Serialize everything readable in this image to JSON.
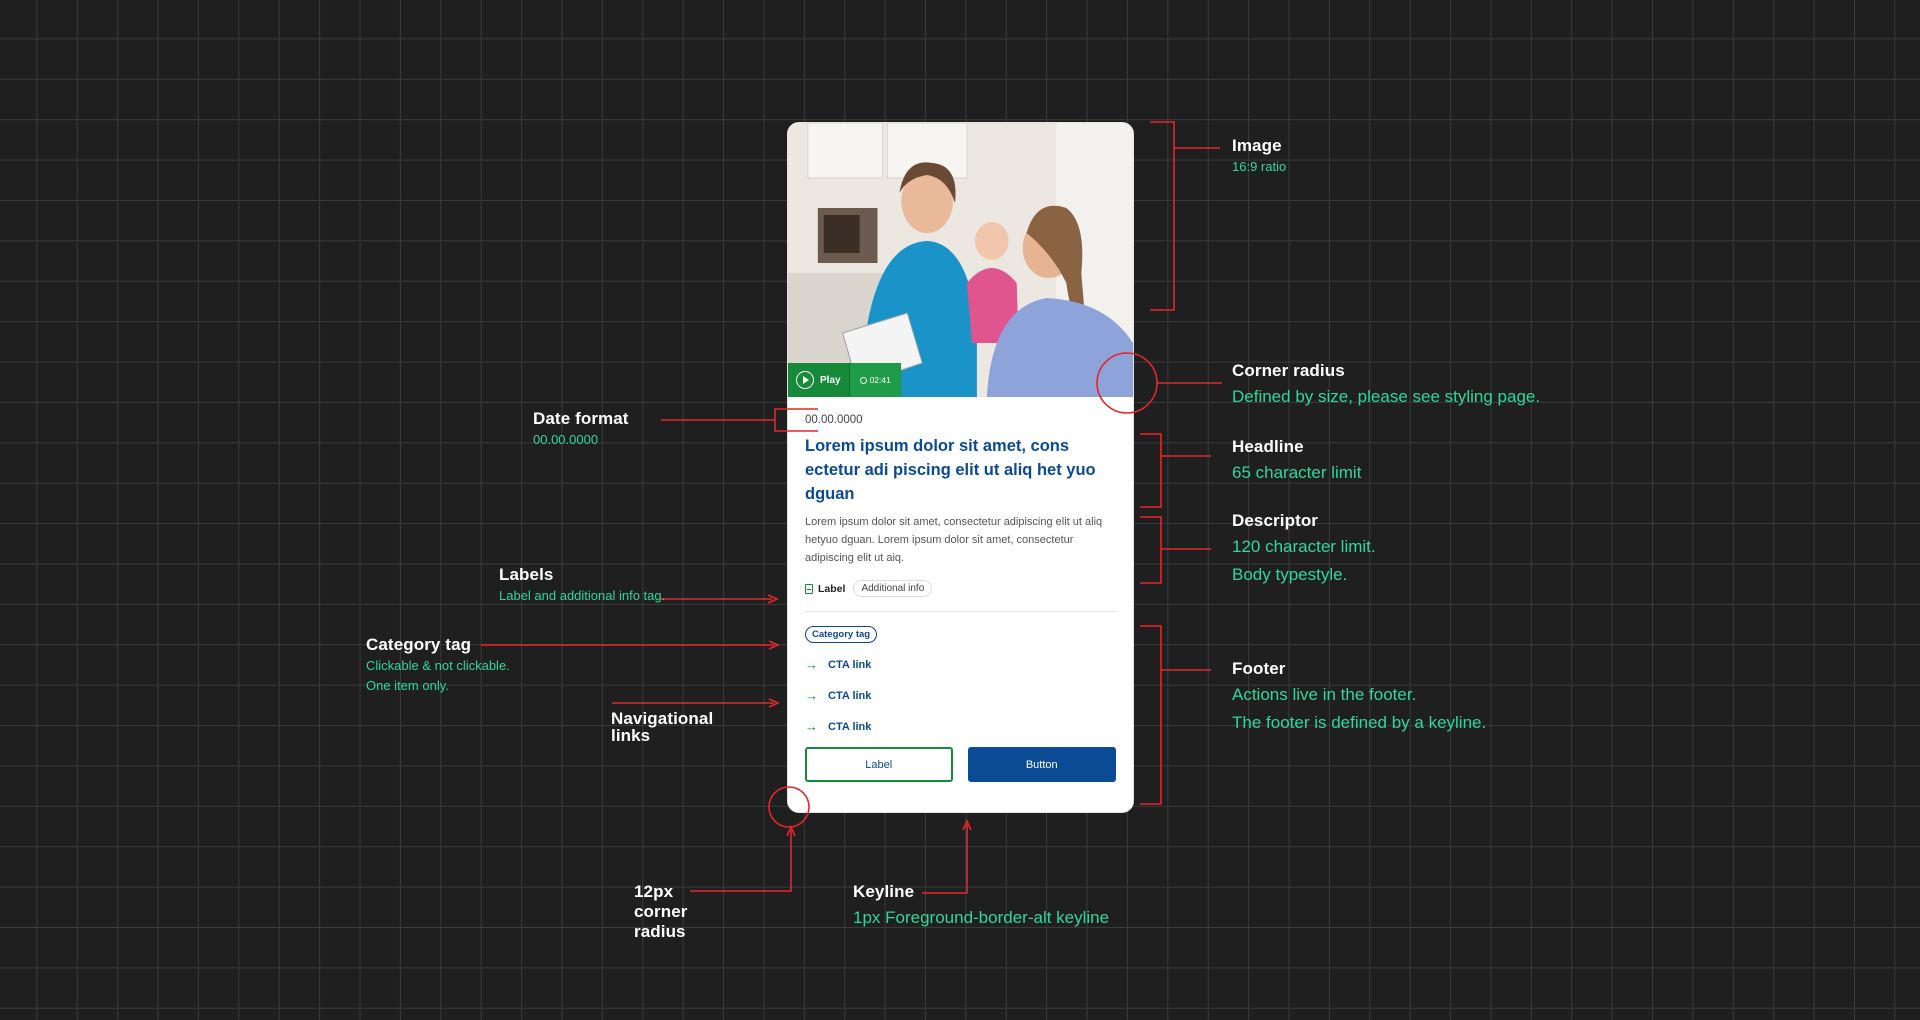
{
  "card": {
    "play_label": "Play",
    "duration": "02:41",
    "date": "00.00.0000",
    "headline": "Lorem ipsum dolor sit amet, cons ectetur adi piscing elit ut aliq het yuo dguan",
    "descriptor": "Lorem ipsum dolor sit amet, consectetur adipiscing elit ut aliq hetyuo dguan. Lorem ipsum dolor sit amet, consectetur adipiscing elit ut aiq.",
    "label": "Label",
    "additional_info": "Additional info",
    "category_tag": "Category tag",
    "cta_links": [
      "CTA link",
      "CTA link",
      "CTA link"
    ],
    "secondary_button": "Label",
    "primary_button": "Button"
  },
  "annotations": {
    "image": {
      "title": "Image",
      "note": "16:9 ratio"
    },
    "corner_radius": {
      "title": "Corner radius",
      "note": "Defined by size, please see styling page."
    },
    "headline": {
      "title": "Headline",
      "note": "65 character limit"
    },
    "descriptor": {
      "title": "Descriptor",
      "note1": "120 character limit.",
      "note2": "Body typestyle."
    },
    "footer": {
      "title": "Footer",
      "note1": "Actions live in the footer.",
      "note2": "The footer is defined by a keyline."
    },
    "date_format": {
      "title": "Date format",
      "note": "00.00.0000"
    },
    "labels": {
      "title": "Labels",
      "note": "Label and additional info tag."
    },
    "category_tag": {
      "title": "Category tag",
      "note1": "Clickable & not clickable.",
      "note2": "One item only."
    },
    "nav_links": {
      "title1": "Navigational",
      "title2": "links"
    },
    "corner_12px": {
      "title1": "12px",
      "title2": "corner",
      "title3": "radius"
    },
    "keyline": {
      "title": "Keyline",
      "note": "1px Foreground-border-alt keyline"
    }
  },
  "colors": {
    "background": "#1f1f1f",
    "annotation_line": "#e3262b",
    "annotation_note": "#2fd6a0",
    "brand_blue": "#0b4a94",
    "brand_green": "#178a3a"
  }
}
